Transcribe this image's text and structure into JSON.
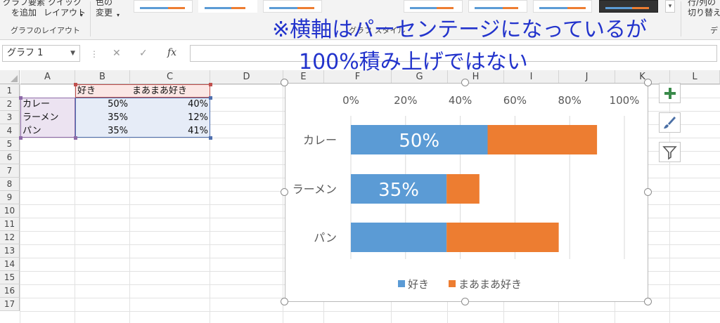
{
  "ribbon": {
    "add_element": "グラフ要素\nを追加",
    "quick_layout": "クイック\nレイアウト",
    "change_color": "色の\n変更",
    "group_layout": "グラフのレイアウト",
    "group_styles": "グラフ スタイル",
    "switch_row_col": "行/列の\n切り替え",
    "data_group": "デ"
  },
  "formula_bar": {
    "name_box": "グラフ 1",
    "fx": "fx",
    "formula": ""
  },
  "annotation": {
    "line1": "※横軸はパーセンテージになっているが",
    "line2": "100%積み上げではない"
  },
  "sheet": {
    "columns": [
      "A",
      "B",
      "C",
      "D",
      "E",
      "F",
      "G",
      "H",
      "I",
      "J",
      "K",
      "L"
    ],
    "rows": [
      "1",
      "2",
      "3",
      "4",
      "5",
      "6",
      "7",
      "8",
      "9",
      "10",
      "11",
      "12",
      "13",
      "14",
      "15",
      "16",
      "17"
    ],
    "header": {
      "b": "好き",
      "c": "まあまあ好き"
    },
    "data": [
      {
        "a": "カレー",
        "b": "50%",
        "c": "40%"
      },
      {
        "a": "ラーメン",
        "b": "35%",
        "c": "12%"
      },
      {
        "a": "パン",
        "b": "35%",
        "c": "41%"
      }
    ]
  },
  "chart_data": {
    "type": "bar",
    "orientation": "horizontal",
    "stacked": true,
    "categories": [
      "カレー",
      "ラーメン",
      "パン"
    ],
    "series": [
      {
        "name": "好き",
        "values": [
          0.5,
          0.35,
          0.35
        ],
        "color": "#5b9bd5"
      },
      {
        "name": "まあまあ好き",
        "values": [
          0.4,
          0.12,
          0.41
        ],
        "color": "#ed7d31"
      }
    ],
    "data_labels": [
      "50%",
      "35%",
      ""
    ],
    "xlim": [
      0,
      1
    ],
    "xticks": [
      "0%",
      "20%",
      "40%",
      "60%",
      "80%",
      "100%"
    ],
    "x_axis_position": "top",
    "grid": true,
    "legend": "bottom",
    "title": ""
  },
  "chart_tools": [
    "plus-icon",
    "brush-icon",
    "filter-icon"
  ]
}
